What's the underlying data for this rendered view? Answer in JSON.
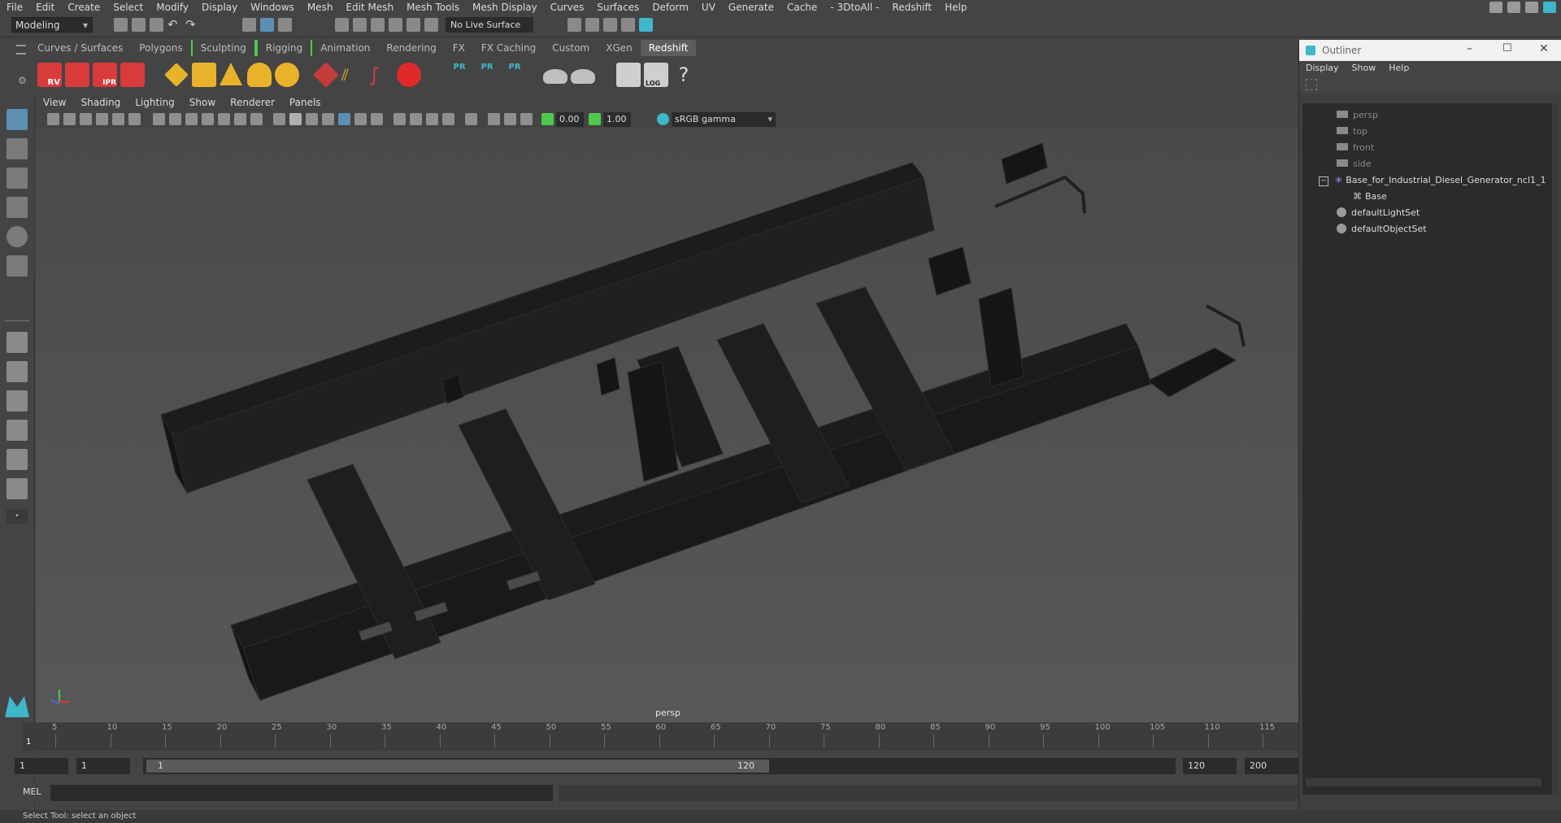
{
  "menubar": {
    "items": [
      "File",
      "Edit",
      "Create",
      "Select",
      "Modify",
      "Display",
      "Windows",
      "Mesh",
      "Edit Mesh",
      "Mesh Tools",
      "Mesh Display",
      "Curves",
      "Surfaces",
      "Deform",
      "UV",
      "Generate",
      "Cache",
      "- 3DtoAll -",
      "Redshift",
      "Help"
    ]
  },
  "statusline": {
    "mode": "Modeling",
    "live_surface": "No Live Surface"
  },
  "shelf": {
    "tabs": [
      "Curves / Surfaces",
      "Polygons",
      "Sculpting",
      "Rigging",
      "Animation",
      "Rendering",
      "FX",
      "FX Caching",
      "Custom",
      "XGen",
      "Redshift"
    ],
    "active_tab": "Redshift",
    "icon_labels": {
      "rv": "RV",
      "ipr": "IPR",
      "pr1": "PR",
      "pr2": "PR",
      "pr3": "PR",
      "log": "LOG",
      "help": "?"
    }
  },
  "panel": {
    "menu": [
      "View",
      "Shading",
      "Lighting",
      "Show",
      "Renderer",
      "Panels"
    ],
    "exposure": "0.00",
    "gamma": "1.00",
    "color_space": "sRGB gamma",
    "camera_label": "persp"
  },
  "timeline": {
    "ticks": [
      "5",
      "10",
      "15",
      "20",
      "25",
      "30",
      "35",
      "40",
      "45",
      "50",
      "55",
      "60",
      "65",
      "70",
      "75",
      "80",
      "85",
      "90",
      "95",
      "100",
      "105",
      "110",
      "115"
    ],
    "current_frame": "1"
  },
  "range": {
    "start": "1",
    "anim_start": "1",
    "slider_start": "1",
    "slider_end": "120",
    "end": "120",
    "anim_end": "200"
  },
  "command": {
    "label": "MEL"
  },
  "helpline": {
    "text": "Select Tool: select an object"
  },
  "outliner": {
    "title": "Outliner",
    "menu": [
      "Display",
      "Show",
      "Help"
    ],
    "items": [
      {
        "label": "persp",
        "dim": true
      },
      {
        "label": "top",
        "dim": true
      },
      {
        "label": "front",
        "dim": true
      },
      {
        "label": "side",
        "dim": true
      },
      {
        "label": "Base_for_Industrial_Diesel_Generator_ncl1_1",
        "dim": false
      },
      {
        "label": "Base",
        "dim": false
      },
      {
        "label": "defaultLightSet",
        "dim": false
      },
      {
        "label": "defaultObjectSet",
        "dim": false
      }
    ]
  },
  "colors": {
    "accent_teal": "#3fb6c9",
    "redshift_red": "#d93a3a",
    "shelf_yellow": "#e8b32a",
    "bracket_green": "#4ec94e"
  }
}
